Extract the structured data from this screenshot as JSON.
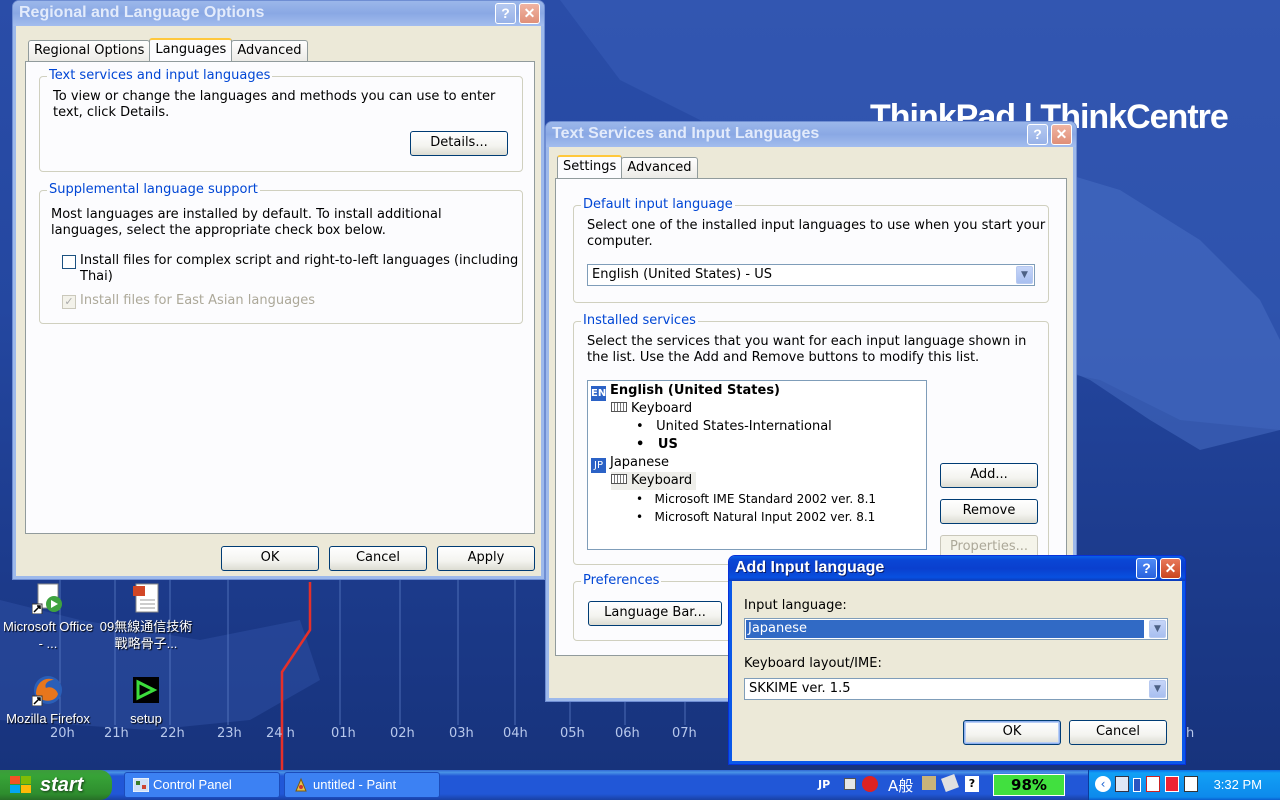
{
  "desktop": {
    "brand": "ThinkPad | ThinkCentre",
    "timezones": [
      "20h",
      "21h",
      "22h",
      "23h",
      "24 h",
      "01h",
      "02h",
      "03h",
      "04h",
      "05h",
      "06h",
      "07h",
      "h"
    ],
    "icons": [
      {
        "label": "Microsoft Office - ...",
        "icon": "office-shortcut-icon"
      },
      {
        "label": "09無線通信技術戰略骨子...",
        "icon": "document-icon"
      },
      {
        "label": "Mozilla Firefox",
        "icon": "firefox-icon"
      },
      {
        "label": "setup",
        "icon": "setup-icon"
      }
    ]
  },
  "regional": {
    "title": "Regional and Language Options",
    "tabs": [
      "Regional Options",
      "Languages",
      "Advanced"
    ],
    "selected_tab": "Languages",
    "text_services": {
      "title": "Text services and input languages",
      "description": "To view or change the languages and methods you can use to enter text, click Details.",
      "details_button": "Details..."
    },
    "supplemental": {
      "title": "Supplemental language support",
      "description": "Most languages are installed by default. To install additional languages, select the appropriate check box below.",
      "complex_script": "Install files for complex script and right-to-left languages (including Thai)",
      "east_asian": "Install files for East Asian languages"
    },
    "ok": "OK",
    "cancel": "Cancel",
    "apply": "Apply"
  },
  "text_services": {
    "title": "Text Services and Input Languages",
    "tabs": [
      "Settings",
      "Advanced"
    ],
    "default_lang": {
      "title": "Default input language",
      "description": "Select one of the installed input languages to use when you start your computer.",
      "value": "English (United States) - US"
    },
    "installed": {
      "title": "Installed services",
      "description": "Select the services that you want for each input language shown in the list. Use the Add and Remove buttons to modify this list.",
      "tree": {
        "english": {
          "badge": "EN",
          "label": "English (United States)",
          "keyboard": "Keyboard",
          "items": [
            "United States-International",
            "US"
          ]
        },
        "japanese": {
          "badge": "JP",
          "label": "Japanese",
          "keyboard": "Keyboard",
          "items": [
            "Microsoft IME Standard 2002 ver. 8.1",
            "Microsoft Natural Input 2002 ver. 8.1"
          ]
        }
      },
      "add": "Add...",
      "remove": "Remove",
      "properties": "Properties..."
    },
    "preferences": {
      "title": "Preferences",
      "language_bar": "Language Bar..."
    }
  },
  "add_input": {
    "title": "Add Input language",
    "input_label": "Input language:",
    "input_value": "Japanese",
    "layout_label": "Keyboard layout/IME:",
    "layout_value": "SKKIME ver. 1.5",
    "ok": "OK",
    "cancel": "Cancel"
  },
  "taskbar": {
    "start": "start",
    "items": [
      "Control Panel",
      "untitled - Paint"
    ],
    "lang_indicator": "JP",
    "ime_text": "A般",
    "battery": "98%",
    "clock": "3:32 PM"
  },
  "colors": {
    "accent": "#0a47d6",
    "group_title": "#0046d5",
    "battery": "#41e03f"
  }
}
